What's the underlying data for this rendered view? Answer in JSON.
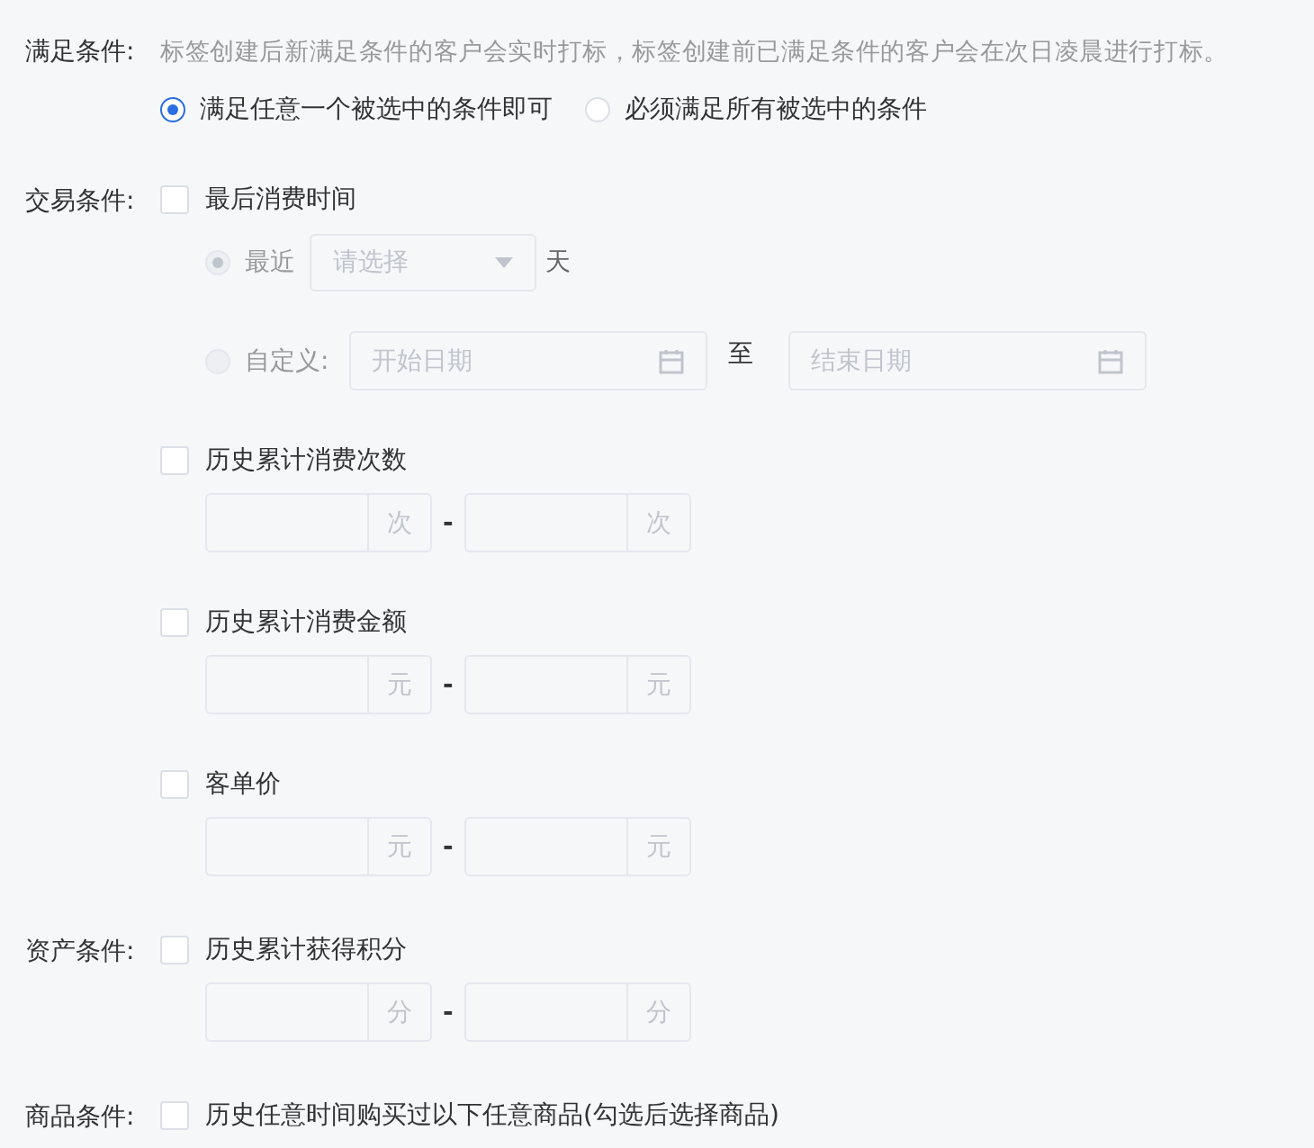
{
  "match_rule": {
    "label": "满足条件:",
    "hint": "标签创建后新满足条件的客户会实时打标，标签创建前已满足条件的客户会在次日凌晨进行打标。",
    "options": [
      {
        "label": "满足任意一个被选中的条件即可",
        "selected": true
      },
      {
        "label": "必须满足所有被选中的条件",
        "selected": false
      }
    ]
  },
  "sections": [
    {
      "label": "交易条件:",
      "items": [
        {
          "kind": "last_spend",
          "label": "最后消费时间",
          "checked": false,
          "recent": {
            "label": "最近",
            "selected": true,
            "disabled": true,
            "placeholder": "请选择",
            "unit": "天"
          },
          "custom": {
            "label": "自定义:",
            "selected": false,
            "disabled": true,
            "start_placeholder": "开始日期",
            "separator": "至",
            "end_placeholder": "结束日期"
          }
        },
        {
          "kind": "range",
          "label": "历史累计消费次数",
          "checked": false,
          "min_unit": "次",
          "separator": "-",
          "max_unit": "次"
        },
        {
          "kind": "range",
          "label": "历史累计消费金额",
          "checked": false,
          "min_unit": "元",
          "separator": "-",
          "max_unit": "元"
        },
        {
          "kind": "range",
          "label": "客单价",
          "checked": false,
          "min_unit": "元",
          "separator": "-",
          "max_unit": "元"
        }
      ]
    },
    {
      "label": "资产条件:",
      "items": [
        {
          "kind": "range",
          "label": "历史累计获得积分",
          "checked": false,
          "min_unit": "分",
          "separator": "-",
          "max_unit": "分"
        }
      ]
    },
    {
      "label": "商品条件:",
      "items": [
        {
          "kind": "plain",
          "label": "历史任意时间购买过以下任意商品(勾选后选择商品)",
          "checked": false
        }
      ]
    }
  ]
}
